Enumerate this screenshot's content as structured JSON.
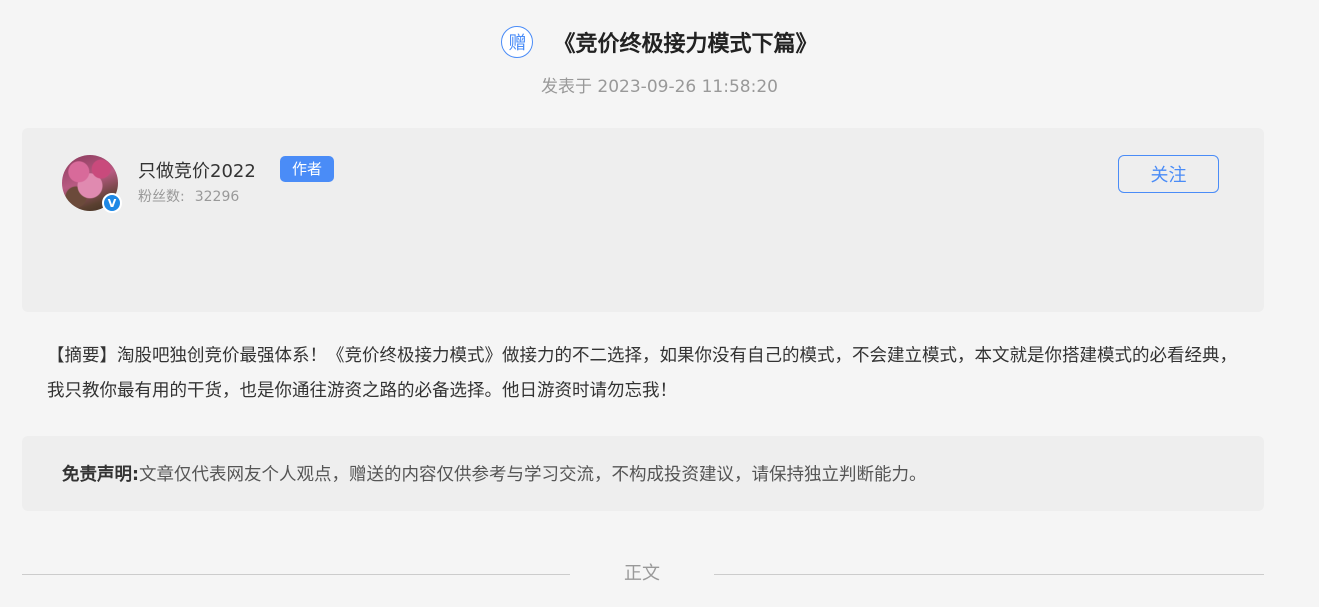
{
  "header": {
    "gift_badge": "赠",
    "title": "《竞价终极接力模式下篇》",
    "publish_text": "发表于 2023-09-26 11:58:20"
  },
  "author": {
    "name": "只做竞价2022",
    "tag": "作者",
    "fans_label": "粉丝数:",
    "fans_count": "32296",
    "verified_mark": "V",
    "follow_label": "关注",
    "avatar_icon": "avatar-photo-pink-flowers",
    "verified_icon": "verified-v-icon"
  },
  "summary": {
    "text": "【摘要】淘股吧独创竞价最强体系！《竞价终极接力模式》做接力的不二选择，如果你没有自己的模式，不会建立模式，本文就是你搭建模式的必看经典，我只教你最有用的干货，也是你通往游资之路的必备选择。他日游资时请勿忘我！"
  },
  "disclaimer": {
    "label": "免责声明:",
    "text": "文章仅代表网友个人观点，赠送的内容仅供参考与学习交流，不构成投资建议，请保持独立判断能力。"
  },
  "divider": {
    "label": "正文"
  },
  "colors": {
    "accent": "#4a8cf7",
    "background": "#f5f5f5",
    "card": "#eeeeee"
  }
}
